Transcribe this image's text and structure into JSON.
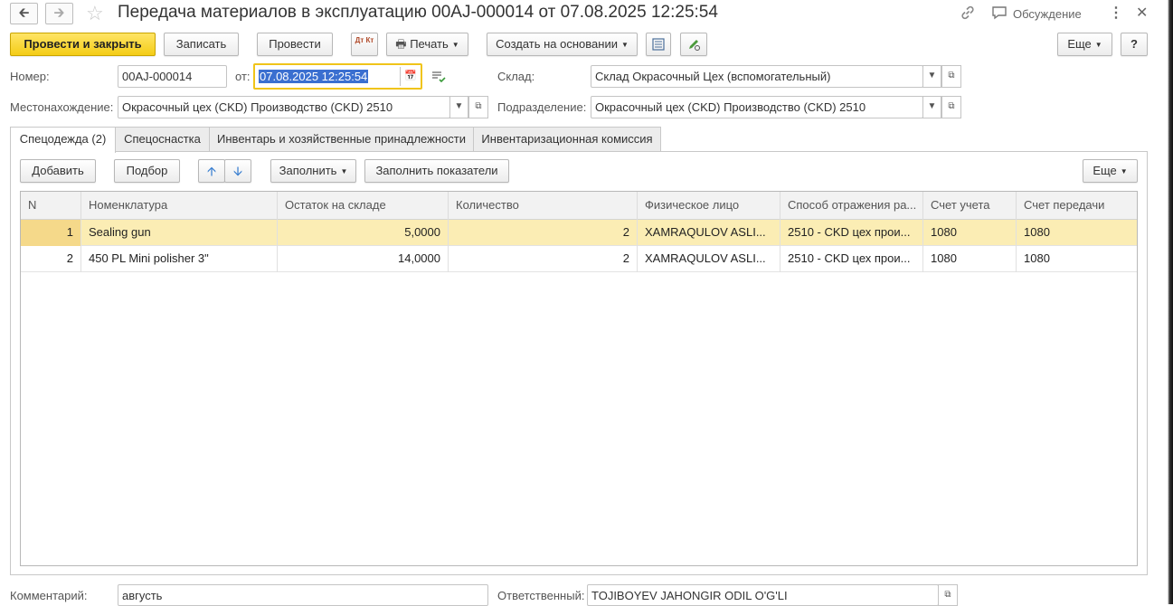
{
  "window": {
    "title": "Передача материалов в эксплуатацию 00AJ-000014 от 07.08.2025 12:25:54",
    "discussion_label": "Обсуждение"
  },
  "toolbar": {
    "post_close": "Провести и закрыть",
    "save": "Записать",
    "post": "Провести",
    "dt_kt": "Дт Кт",
    "print": "Печать",
    "create_based": "Создать на основании",
    "more": "Еще",
    "help": "?"
  },
  "form": {
    "number_label": "Номер:",
    "number_value": "00AJ-000014",
    "date_label": "от:",
    "date_value": "07.08.2025 12:25:54",
    "warehouse_label": "Склад:",
    "warehouse_value": "Склад  Окрасочный Цех (вспомогательный)",
    "location_label": "Местонахождение:",
    "location_value": "Окрасочный цех (CKD) Производство (CKD) 2510",
    "division_label": "Подразделение:",
    "division_value": "Окрасочный цех (CKD) Производство (CKD) 2510"
  },
  "tabs": [
    {
      "label": "Спецодежда (2)",
      "active": true
    },
    {
      "label": "Спецоснастка",
      "active": false
    },
    {
      "label": "Инвентарь и хозяйственные принадлежности",
      "active": false
    },
    {
      "label": "Инвентаризационная комиссия",
      "active": false
    }
  ],
  "table_toolbar": {
    "add": "Добавить",
    "pick": "Подбор",
    "fill": "Заполнить",
    "fill_indicators": "Заполнить показатели",
    "more": "Еще"
  },
  "table": {
    "columns": [
      "N",
      "Номенклатура",
      "Остаток на складе",
      "Количество",
      "Физическое лицо",
      "Способ отражения ра...",
      "Счет учета",
      "Счет передачи"
    ],
    "rows": [
      {
        "n": "1",
        "item": "Sealing gun",
        "stock": "5,0000",
        "qty": "2",
        "person": "XAMRAQULOV ASLI...",
        "method": "2510 - CKD цех прои...",
        "account": "1080",
        "transfer": "1080"
      },
      {
        "n": "2",
        "item": "450 PL Mini polisher 3\"",
        "stock": "14,0000",
        "qty": "2",
        "person": "XAMRAQULOV ASLI...",
        "method": "2510 - CKD цех прои...",
        "account": "1080",
        "transfer": "1080"
      }
    ]
  },
  "footer": {
    "comment_label": "Комментарий:",
    "comment_value": "августь",
    "responsible_label": "Ответственный:",
    "responsible_value": "TOJIBOYEV JAHONGIR ODIL O'G'LI"
  },
  "colors": {
    "primary_button": "#f4cd16",
    "selected_row": "#fbedb4",
    "focus_border": "#f0c419",
    "selection_blue": "#3a6fd0"
  }
}
